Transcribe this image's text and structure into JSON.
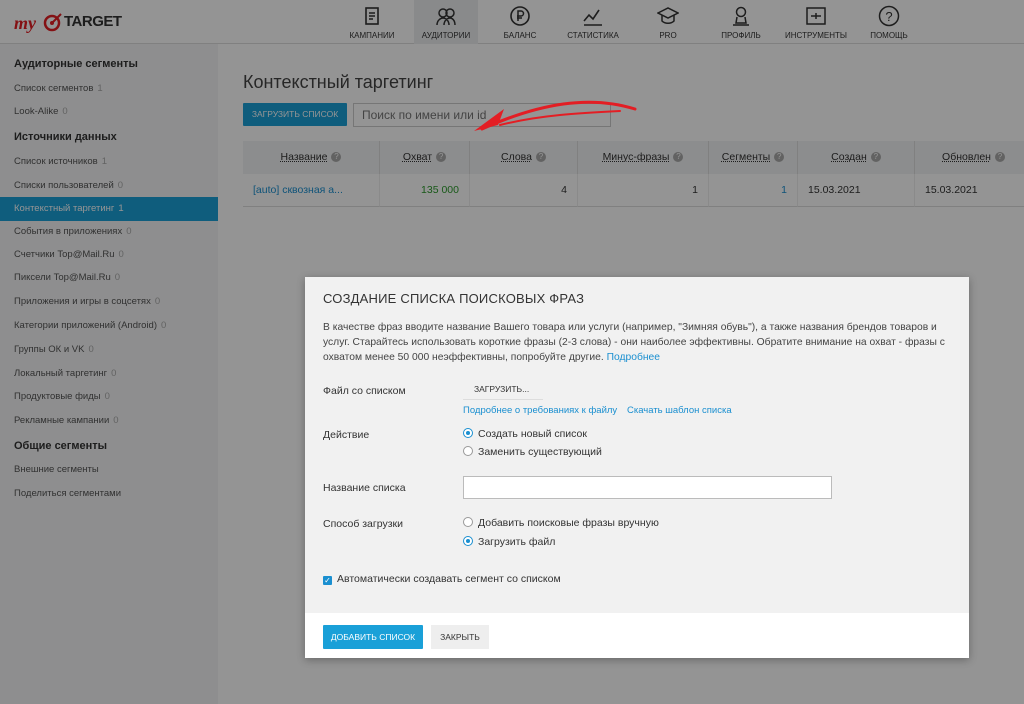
{
  "brand": {
    "logo_text": "TARGET",
    "accent": "#e31e24"
  },
  "nav": [
    {
      "label": "Кампании",
      "icon": "campaigns-icon"
    },
    {
      "label": "Аудитории",
      "icon": "audiences-icon",
      "active": true
    },
    {
      "label": "Баланс",
      "icon": "balance-icon"
    },
    {
      "label": "Статистика",
      "icon": "statistics-icon"
    },
    {
      "label": "PRO",
      "icon": "pro-icon"
    },
    {
      "label": "Профиль",
      "icon": "profile-icon"
    },
    {
      "label": "Инструменты",
      "icon": "tools-icon"
    },
    {
      "label": "Помощь",
      "icon": "help-icon"
    }
  ],
  "sidebar": {
    "h1": "Аудиторные сегменты",
    "h2": "Источники данных",
    "h3": "Общие сегменты",
    "items": [
      {
        "label": "Список сегментов",
        "count": "1"
      },
      {
        "label": "Look-Alike",
        "count": "0"
      },
      {
        "label": "Список источников",
        "count": "1"
      },
      {
        "label": "Списки пользователей",
        "count": "0"
      },
      {
        "label": "Контекстный таргетинг",
        "count": "1"
      },
      {
        "label": "События в приложениях",
        "count": "0"
      },
      {
        "label": "Счетчики Top@Mail.Ru",
        "count": "0"
      },
      {
        "label": "Пиксели Top@Mail.Ru",
        "count": "0"
      },
      {
        "label": "Приложения и игры в соцсетях",
        "count": "0"
      },
      {
        "label": "Категории приложений (Android)",
        "count": "0"
      },
      {
        "label": "Группы ОК и VK",
        "count": "0"
      },
      {
        "label": "Локальный таргетинг",
        "count": "0"
      },
      {
        "label": "Продуктовые фиды",
        "count": "0"
      },
      {
        "label": "Рекламные кампании",
        "count": "0"
      },
      {
        "label": "Внешние сегменты",
        "count": ""
      },
      {
        "label": "Поделиться сегментами",
        "count": ""
      }
    ]
  },
  "main": {
    "title": "Контекстный таргетинг",
    "upload_label": "Загрузить список",
    "search_placeholder": "Поиск по имени или id"
  },
  "table": {
    "headers": [
      "Название",
      "Охват",
      "Слова",
      "Минус-фразы",
      "Сегменты",
      "Создан",
      "Обновлен"
    ],
    "row": [
      "[auto] сквозная а...",
      "135 000",
      "4",
      "1",
      "1",
      "15.03.2021",
      "15.03.2021"
    ]
  },
  "modal": {
    "title": "Создание списка поисковых фраз",
    "desc": "В качестве фраз вводите название Вашего товара или услуги (например, \"Зимняя обувь\"), а также названия брендов товаров и услуг. Старайтесь использовать короткие фразы (2-3 слова) - они наиболее эффективны. Обратите внимание на охват - фразы с охватом менее 50 000 неэффективны, попробуйте другие.",
    "desc_link": "Подробнее",
    "file_label": "Файл со списком",
    "upload_btn": "Загрузить...",
    "req_link": "Подробнее о требованиях к файлу",
    "template_link": "Скачать шаблон списка",
    "action_label": "Действие",
    "action_new": "Создать новый список",
    "action_replace": "Заменить существующий",
    "name_label": "Название списка",
    "name_value": "",
    "method_label": "Способ загрузки",
    "method_manual": "Добавить поисковые фразы вручную",
    "method_file": "Загрузить файл",
    "auto_segment": "Автоматически создавать сегмент со списком",
    "add_btn": "Добавить список",
    "close_btn": "Закрыть"
  }
}
